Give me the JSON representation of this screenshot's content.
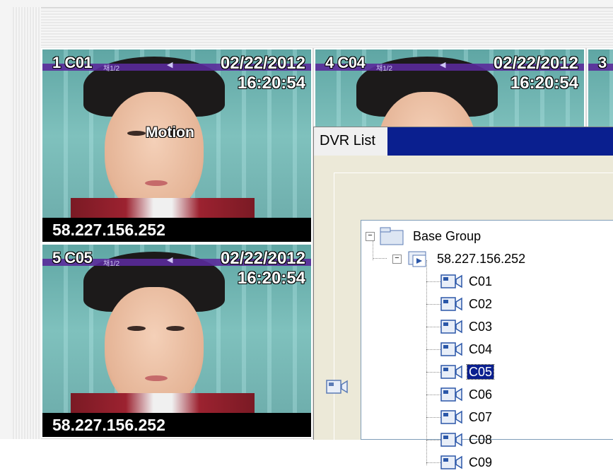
{
  "tiles": [
    {
      "label": "1 C01",
      "sub": "채1/2",
      "date": "02/22/2012",
      "time": "16:20:54",
      "ip": "58.227.156.252",
      "event": "Motion"
    },
    {
      "label": "4 C04",
      "sub": "채1/2",
      "date": "02/22/2012",
      "time": "16:20:54",
      "ip": "",
      "event": ""
    },
    {
      "label": "3",
      "sub": "",
      "date": "",
      "time": "",
      "ip": "",
      "event": ""
    },
    {
      "label": "5 C05",
      "sub": "채1/2",
      "date": "02/22/2012",
      "time": "16:20:54",
      "ip": "58.227.156.252",
      "event": ""
    }
  ],
  "dialog": {
    "title": "DVR List",
    "tree": {
      "group": "Base Group",
      "dvr": "58.227.156.252",
      "cameras": [
        "C01",
        "C02",
        "C03",
        "C04",
        "C05",
        "C06",
        "C07",
        "C08",
        "C09"
      ],
      "selected": "C05"
    }
  },
  "icons": {
    "group": "folder-group-icon",
    "dvr": "dvr-device-icon",
    "camera": "camera-icon"
  },
  "colors": {
    "selection": "#0a1f8f",
    "osd_bar": "#5a2a9a",
    "title_bar": "#0a1f8f"
  }
}
